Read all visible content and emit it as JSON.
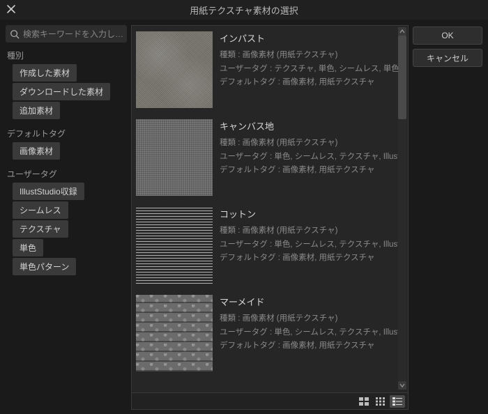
{
  "title": "用紙テクスチャ素材の選択",
  "search": {
    "placeholder": "検索キーワードを入力し…"
  },
  "buttons": {
    "ok": "OK",
    "cancel": "キャンセル"
  },
  "sidebar": {
    "groups": [
      {
        "label": "種別",
        "items": [
          "作成した素材",
          "ダウンロードした素材",
          "追加素材"
        ]
      },
      {
        "label": "デフォルトタグ",
        "items": [
          "画像素材"
        ]
      },
      {
        "label": "ユーザータグ",
        "items": [
          "IllustStudio収録",
          "シームレス",
          "テクスチャ",
          "単色",
          "単色パターン"
        ]
      }
    ]
  },
  "fieldLabels": {
    "kind": "種類 :",
    "userTags": "ユーザータグ :",
    "defaultTags": "デフォルトタグ :"
  },
  "results": [
    {
      "name": "インパスト",
      "kind": "画像素材 (用紙テクスチャ)",
      "userTags": "テクスチャ, 単色, シームレス, 単色パターン",
      "defaultTags": "画像素材, 用紙テクスチャ",
      "tex": "tex-impasto"
    },
    {
      "name": "キャンバス地",
      "kind": "画像素材 (用紙テクスチャ)",
      "userTags": "単色, シームレス, テクスチャ, IllustStudio収録",
      "defaultTags": "画像素材, 用紙テクスチャ",
      "tex": "tex-canvas"
    },
    {
      "name": "コットン",
      "kind": "画像素材 (用紙テクスチャ)",
      "userTags": "単色, シームレス, テクスチャ, IllustStudio収録",
      "defaultTags": "画像素材, 用紙テクスチャ",
      "tex": "tex-cotton"
    },
    {
      "name": "マーメイド",
      "kind": "画像素材 (用紙テクスチャ)",
      "userTags": "単色, シームレス, テクスチャ, IllustStudio収録",
      "defaultTags": "画像素材, 用紙テクスチャ",
      "tex": "tex-mermaid"
    }
  ],
  "viewMode": "detail"
}
